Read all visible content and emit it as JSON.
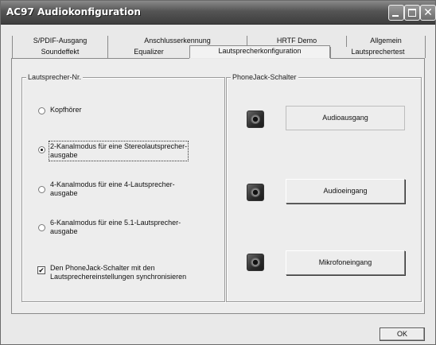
{
  "window": {
    "title": "AC97 Audiokonfiguration"
  },
  "tabs": {
    "row1": [
      "S/PDIF-Ausgang",
      "Anschlusserkennung",
      "HRTF Demo",
      "Allgemein"
    ],
    "row2": [
      "Soundeffekt",
      "Equalizer",
      "Lautsprecherkonfiguration",
      "Lautsprechertest"
    ],
    "active": "Lautsprecherkonfiguration"
  },
  "speaker_group": {
    "legend": "Lautsprecher-Nr.",
    "options": [
      {
        "lines": [
          "Kopfhörer"
        ],
        "selected": false
      },
      {
        "lines": [
          "2-Kanalmodus für eine Stereolautsprecher-",
          "ausgabe"
        ],
        "selected": true
      },
      {
        "lines": [
          "4-Kanalmodus für eine 4-Lautsprecher-",
          "ausgabe"
        ],
        "selected": false
      },
      {
        "lines": [
          "6-Kanalmodus für eine 5.1-Lautsprecher-",
          "ausgabe"
        ],
        "selected": false
      }
    ],
    "sync": {
      "lines": [
        "Den PhoneJack-Schalter mit den",
        "Lautsprechereinstellungen synchronisieren"
      ],
      "checked": true,
      "check_glyph": "✔"
    }
  },
  "phonejack_group": {
    "legend": "PhoneJack-Schalter",
    "buttons": [
      {
        "label": "Audioausgang",
        "enabled": false
      },
      {
        "label": "Audioeingang",
        "enabled": true
      },
      {
        "label": "Mikrofoneingang",
        "enabled": true
      }
    ]
  },
  "footer": {
    "ok_label": "OK"
  },
  "icons": {
    "minimize": "minimize-icon",
    "maximize": "maximize-icon",
    "close": "close-icon",
    "close_glyph": "✕",
    "jack": "audio-jack-icon"
  }
}
